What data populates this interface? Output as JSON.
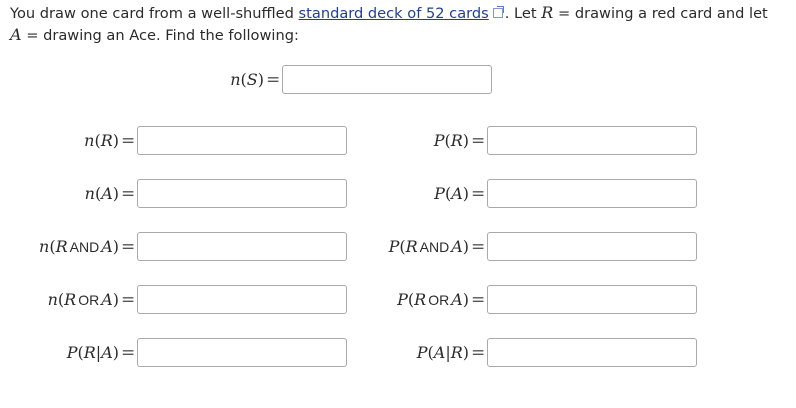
{
  "intro": {
    "part1": "You draw one card from a well-shuffled ",
    "link_text": "standard deck of 52 cards",
    "part2": ". Let ",
    "var_r": "R",
    "part3": " = drawing a red card and let ",
    "var_a": "A",
    "part4": " = drawing an Ace. Find the following:"
  },
  "fields": {
    "nS": {
      "fn": "n",
      "open": "(",
      "a": "S",
      "op": "",
      "b": "",
      "close": ")",
      "eq": "=",
      "value": ""
    },
    "nR": {
      "fn": "n",
      "open": "(",
      "a": "R",
      "op": "",
      "b": "",
      "close": ")",
      "eq": "=",
      "value": ""
    },
    "PR": {
      "fn": "P",
      "open": "(",
      "a": "R",
      "op": "",
      "b": "",
      "close": ")",
      "eq": "=",
      "value": ""
    },
    "nA": {
      "fn": "n",
      "open": "(",
      "a": "A",
      "op": "",
      "b": "",
      "close": ")",
      "eq": "=",
      "value": ""
    },
    "PA": {
      "fn": "P",
      "open": "(",
      "a": "A",
      "op": "",
      "b": "",
      "close": ")",
      "eq": "=",
      "value": ""
    },
    "nRandA": {
      "fn": "n",
      "open": "(",
      "a": "R",
      "op": "AND",
      "b": "A",
      "close": ")",
      "eq": "=",
      "value": ""
    },
    "PRandA": {
      "fn": "P",
      "open": "(",
      "a": "R",
      "op": "AND",
      "b": "A",
      "close": ")",
      "eq": "=",
      "value": ""
    },
    "nRorA": {
      "fn": "n",
      "open": "(",
      "a": "R",
      "op": "OR",
      "b": "A",
      "close": ")",
      "eq": "=",
      "value": ""
    },
    "PRorA": {
      "fn": "P",
      "open": "(",
      "a": "R",
      "op": "OR",
      "b": "A",
      "close": ")",
      "eq": "=",
      "value": ""
    },
    "PRgivenA": {
      "fn": "P",
      "open": "(",
      "a": "R",
      "op": "|",
      "b": "A",
      "close": ")",
      "eq": "=",
      "value": ""
    },
    "PAgivenR": {
      "fn": "P",
      "open": "(",
      "a": "A",
      "op": "|",
      "b": "R",
      "close": ")",
      "eq": "=",
      "value": ""
    }
  },
  "colors": {
    "link": "#1f3f94",
    "border": "#a9a9a9",
    "text": "#2b2b2b"
  },
  "icons": {
    "external_link": "external-link-icon"
  }
}
